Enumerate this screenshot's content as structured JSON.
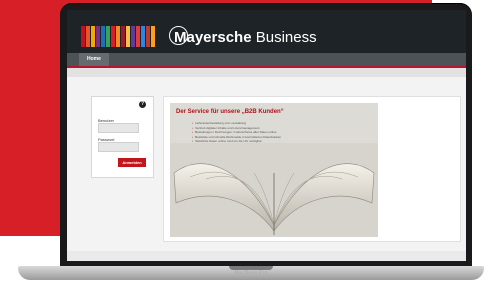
{
  "brand": {
    "name_bold": "Mayersche",
    "name_rest": " Business"
  },
  "nav": {
    "home": "Home"
  },
  "login": {
    "user_label": "Benutzer",
    "password_label": "Passwort",
    "submit": "Anmelden",
    "help": "?"
  },
  "hero": {
    "title": "Der Service für unsere „B2B Kunden“",
    "bullets": [
      "Lieferantenbestellung und -verwaltung",
      "Vertrieb digitaler Inhalte und Lizenzmanagement",
      "Bestellungen / Rechnungen / Lieferscheine aller Daten online",
      "Bestände und schnelle Rückmelde in kontrollierten Datenbanken",
      "Sämtliche Daten online rund um die Uhr verfügbar"
    ]
  },
  "device": {
    "model": "MacBook Pro"
  },
  "colors": {
    "background_red": "#d61f26",
    "header": "#1e2328",
    "accent": "#c2161c",
    "logo_bars": [
      "#c1121f",
      "#e4572e",
      "#f2a900",
      "#7b2d8b",
      "#1f6fb2",
      "#3aa05b",
      "#d61f26",
      "#f28c28",
      "#9b1b30",
      "#f2c14e",
      "#5a3e99",
      "#e03a3e",
      "#2e86de",
      "#c0392b",
      "#ff9f1c"
    ]
  },
  "icons": {
    "help": "question-circle-icon"
  }
}
